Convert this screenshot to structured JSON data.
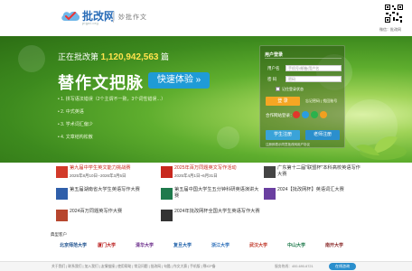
{
  "header": {
    "logo_cn": "批改网",
    "logo_en": "pigai.org",
    "slogan": "妙批作文",
    "qr_caption": "微信：批改网"
  },
  "banner": {
    "counter_prefix": "正在批改第",
    "counter_value": "1,120,942,563",
    "counter_suffix": "篇",
    "headline": "替作文把脉",
    "cta": "快速体验 »",
    "features": [
      "1. 拼写语法错误（2个主谓不一致，3个词性错误…）",
      "2. 中式英语",
      "3. 学术词汇偏少",
      "4. 文章结构松散"
    ]
  },
  "login": {
    "title": "用户登录",
    "username_label": "用户名",
    "username_placeholder": "手机号/邮箱/用户名",
    "password_label": "密 码",
    "password_placeholder": "密码",
    "remember": "记住登录状态",
    "login_button": "登 录",
    "forgot": "忘记密码 | 找回账号",
    "partner_login": "合作网站登录：",
    "student_register": "学生注册",
    "teacher_register": "老师注册",
    "terms": "注册即表示同意批改网用户协议"
  },
  "news": [
    {
      "title": "第九届中学生英文能力挑战赛",
      "date": "2025年8月10日--2026年3月5日",
      "red": true,
      "icon_color": "#d23a2a"
    },
    {
      "title": "2025年百万同题英文写作活动",
      "date": "2025年4月1日~6月31日",
      "red": true,
      "icon_color": "#c8281e"
    },
    {
      "title": "广东第十二届\"联盟杯\"本科高校英语写作大赛",
      "date": "",
      "red": false,
      "icon_color": "#444"
    },
    {
      "title": "第五届湖南省大学生英语写作大赛",
      "date": "",
      "red": false,
      "icon_color": "#2f5faa"
    },
    {
      "title": "第五届中国大学生五分钟科研英语演讲大赛",
      "date": "",
      "red": false,
      "icon_color": "#1f7a4c"
    },
    {
      "title": "2024【批改网杯】英语词汇大赛",
      "date": "",
      "red": false,
      "icon_color": "#6a3fa0"
    },
    {
      "title": "2024百万同题英写作大赛",
      "date": "",
      "red": false,
      "icon_color": "#b7462e"
    },
    {
      "title": "2024年批改网杯全国大学生英语写作大赛",
      "date": "",
      "red": false,
      "icon_color": "#333"
    }
  ],
  "partners": {
    "label": "典型客户",
    "logos": [
      {
        "name": "北京师范大学",
        "color": "#1a4e8c"
      },
      {
        "name": "厦门大学",
        "color": "#b22"
      },
      {
        "name": "清华大学",
        "color": "#6a2c8a"
      },
      {
        "name": "复旦大学",
        "color": "#1b5ea8"
      },
      {
        "name": "浙江大学",
        "color": "#2a6db8"
      },
      {
        "name": "武汉大学",
        "color": "#c0392b"
      },
      {
        "name": "中山大学",
        "color": "#1f7a4c"
      },
      {
        "name": "南开大学",
        "color": "#8a2a2a"
      }
    ]
  },
  "footer": {
    "links": "关于我们 | 联系我们 | 加入我们 | 友情链接 | 使用帮助 | 常见问题 | 批改网 | 句酷 | 作文大赛 | 手机版 | 鄂ICP备",
    "hotline": "服务热线：400-690-6721",
    "chat": "在线咨询"
  },
  "colors": {
    "brand_blue": "#2a6db8",
    "banner_green": "#4a9a26",
    "counter_yellow": "#ffe34d",
    "cta_blue": "#1f9bd6",
    "login_orange": "#f5a623",
    "news_red": "#c8281e"
  },
  "icons": [
    "logo-check-icon",
    "qr-code-icon",
    "weibo-icon",
    "qq-icon",
    "wechat-icon",
    "news-badge-icon",
    "leaf-icon"
  ]
}
